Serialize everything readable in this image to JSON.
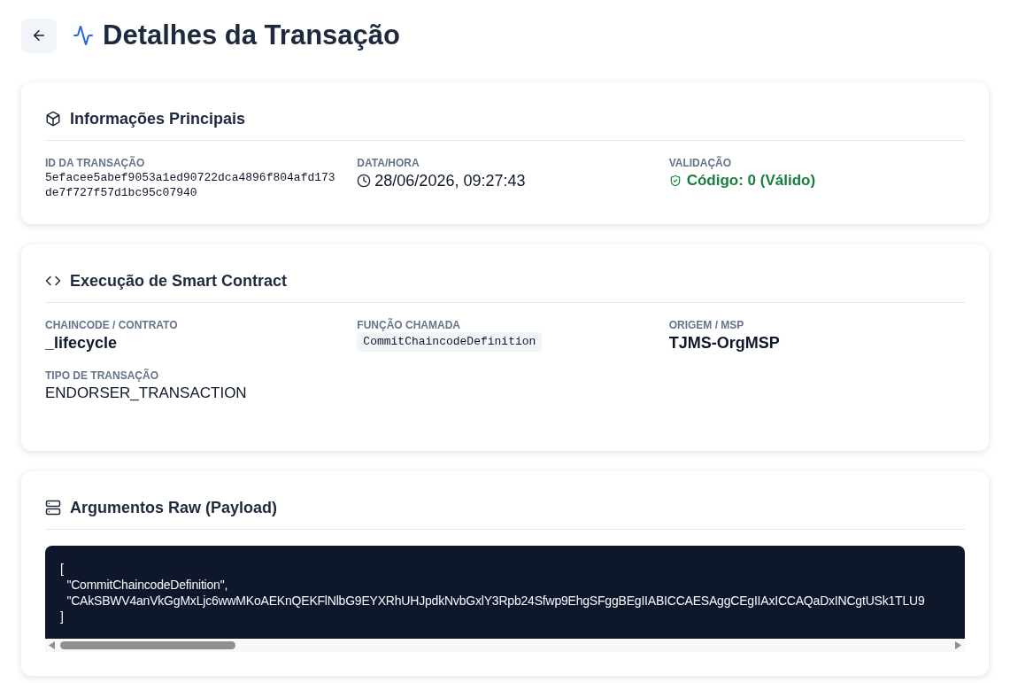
{
  "header": {
    "title": "Detalhes da Transação"
  },
  "sections": [
    {
      "kind": "info",
      "title": "Informações Principais",
      "fields": [
        {
          "kind": "hash",
          "label": "ID DA TRANSAÇÃO",
          "value": "5efacee5abef9053a1ed90722dca4896f804afd173de7f727f57d1bc95c07940"
        },
        {
          "kind": "datetime",
          "label": "DATA/HORA",
          "value": "28/06/2026, 09:27:43"
        },
        {
          "kind": "status",
          "label": "VALIDAÇÃO",
          "value": "Código: 0 (Válido)",
          "valid": true
        }
      ]
    },
    {
      "kind": "contract",
      "title": "Execução de Smart Contract",
      "fields": [
        {
          "kind": "strong",
          "label": "CHAINCODE / CONTRATO",
          "value": "_lifecycle"
        },
        {
          "kind": "code",
          "label": "FUNÇÃO CHAMADA",
          "value": "CommitChaincodeDefinition"
        },
        {
          "kind": "strong",
          "label": "ORIGEM / MSP",
          "value": "TJMS-OrgMSP"
        },
        {
          "kind": "plain",
          "label": "TIPO DE TRANSAÇÃO",
          "value": "ENDORSER_TRANSACTION"
        }
      ]
    },
    {
      "kind": "payload",
      "title": "Argumentos Raw (Payload)",
      "code": "[\n  \"CommitChaincodeDefinition\",\n  \"CAkSBWV4anVkGgMxLjc6wwMKoAEKnQEKFlNlbG9EYXRhUHJpdkNvbGxlY3Rpb24Sfwp9EhgSFggBEgIIABICCAESAggCEgIIAxICCAQaDxINCgtUSk1TLU9\n]"
    }
  ]
}
